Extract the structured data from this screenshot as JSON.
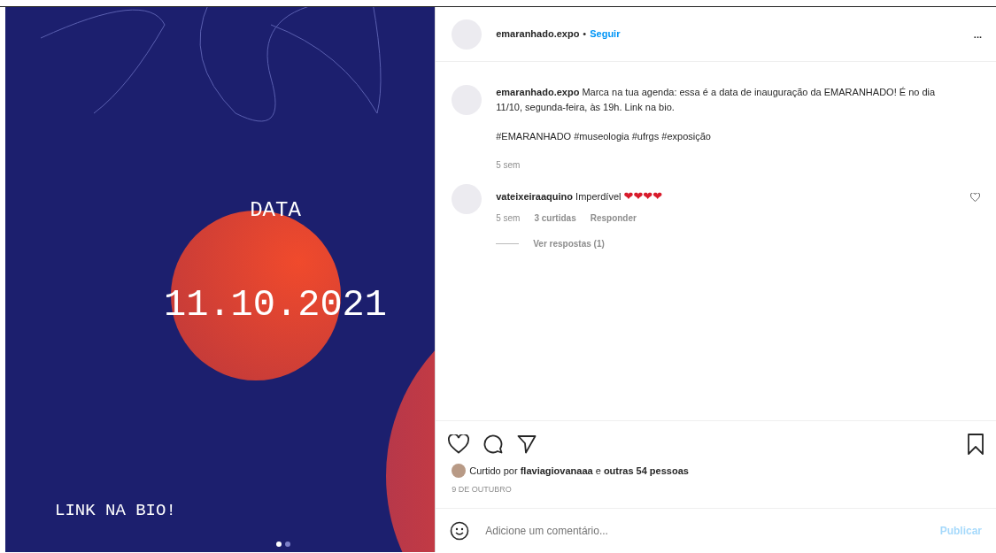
{
  "slide": {
    "title": "DATA",
    "date": "11.10.2021",
    "footer": "LINK NA BIO!",
    "dots": [
      {
        "selected": true
      },
      {
        "selected": false
      }
    ]
  },
  "header": {
    "username": "emaranhado.expo",
    "separator": "•",
    "follow": "Seguir",
    "more": "..."
  },
  "caption": {
    "username": "emaranhado.expo",
    "text": "Marca na tua agenda: essa é a data de inauguração da EMARANHADO! É no dia 11/10, segunda-feira, às 19h. Link na bio.",
    "hashtags": "#EMARANHADO #museologia #ufrgs #exposição",
    "time": "5 sem"
  },
  "comments": [
    {
      "username": "vateixeiraaquino",
      "text": "Imperdível",
      "emoji": "❤❤❤❤",
      "time": "5 sem",
      "likes": "3 curtidas",
      "reply": "Responder",
      "view_replies": "Ver respostas (1)",
      "liked": false
    }
  ],
  "actions": {
    "liked": false,
    "saved": false
  },
  "likes": "Curtido por **flaviagiovanaaa** e **outras 54 pessoas**",
  "date": "9 DE OUTUBRO",
  "comment_box": {
    "placeholder": "Adicione um comentário...",
    "publish": "Publicar",
    "publish_disabled": true
  }
}
